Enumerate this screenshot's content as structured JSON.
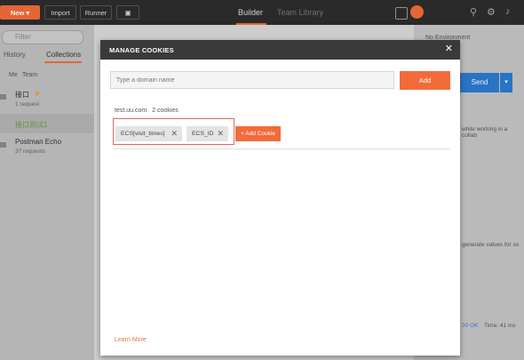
{
  "toolbar": {
    "new_label": "New",
    "import_label": "Import",
    "runner_label": "Runner",
    "builder_label": "Builder",
    "team_library_label": "Team Library"
  },
  "sidebar": {
    "filter_placeholder": "Filter",
    "history_tab": "History",
    "collections_tab": "Collections",
    "me_label": "Me",
    "team_label": "Team",
    "items": [
      {
        "title": "接口",
        "subtitle": "1 request"
      },
      {
        "title": "接口测试1",
        "subtitle": ""
      },
      {
        "title": "Postman Echo",
        "subtitle": "37 requests"
      }
    ]
  },
  "right_panel": {
    "environment": "No Environment",
    "send_label": "Send",
    "hint1": "while working in a collab",
    "hint2": "generate values for so",
    "status": "00 OK",
    "time": "Time: 41 ms"
  },
  "modal": {
    "title": "MANAGE COOKIES",
    "domain_placeholder": "Type a domain name",
    "add_label": "Add",
    "domain": "test.uu.com",
    "cookie_count": "2 cookies",
    "cookies": [
      "ECS[visit_times]",
      "ECS_ID"
    ],
    "add_cookie_label": "+ Add Cookie",
    "learn_more": "Learn More"
  },
  "colors": {
    "accent": "#f26b3a",
    "header": "#3a3a3a",
    "send": "#2b7bd0",
    "highlight": "#e06666"
  }
}
